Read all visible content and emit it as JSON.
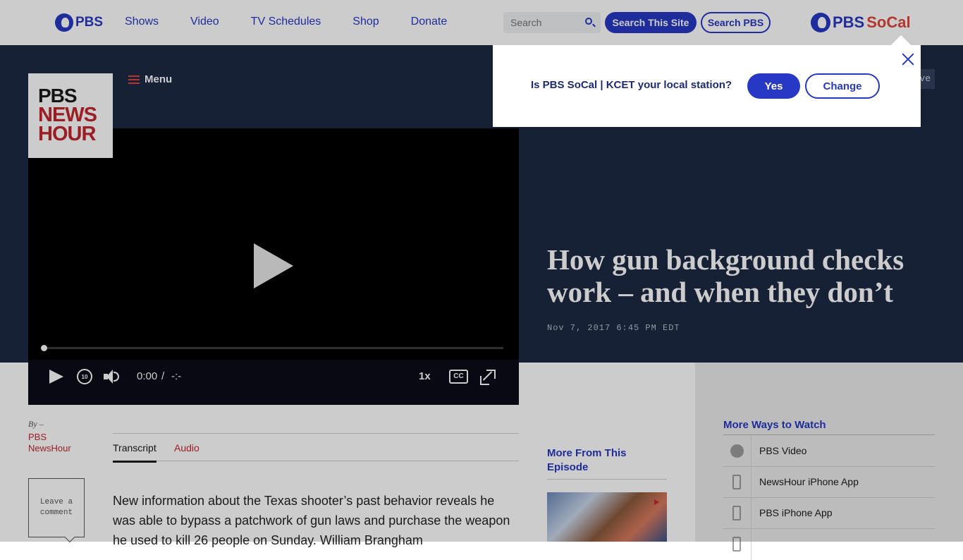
{
  "topbar": {
    "logo_text": "PBS",
    "nav": [
      "Shows",
      "Video",
      "TV Schedules",
      "Shop",
      "Donate"
    ],
    "search_placeholder": "Search",
    "search_site_label": "Search This Site",
    "search_pbs_label": "Search PBS",
    "station_logo_pbs": "PBS",
    "station_logo_name": "SoCal"
  },
  "newshour": {
    "logo_line1": "PBS",
    "logo_line2": "NEWS",
    "logo_line3": "HOUR",
    "menu_label": "Menu"
  },
  "player": {
    "time_current": "0:00",
    "time_separator": "/",
    "time_total": "-:-",
    "speed": "1x",
    "cc_label": "CC",
    "rewind_label": "10",
    "progress_fraction": 0
  },
  "article": {
    "headline": "How gun background checks work – and when they don’t",
    "date": "Nov 7, 2017 6:45 PM EDT",
    "save_label": "ve",
    "by_label": "By –",
    "author": "PBS NewsHour",
    "comment_label": "Leave a comment",
    "tabs": [
      "Transcript",
      "Audio"
    ],
    "body": "New information about the Texas shooter’s past behavior reveals he was able to bypass a patchwork of gun laws and purchase the weapon he used to kill 26 people on Sunday. William Brangham"
  },
  "popup": {
    "question": "Is PBS SoCal | KCET your local station?",
    "yes_label": "Yes",
    "change_label": "Change"
  },
  "more_episode": {
    "title": "More From This Episode"
  },
  "more_ways": {
    "title": "More Ways to Watch",
    "items": [
      {
        "label": "PBS Video",
        "icon": "pbs-icon"
      },
      {
        "label": "NewsHour iPhone App",
        "icon": "phone-icon"
      },
      {
        "label": "PBS iPhone App",
        "icon": "phone-icon"
      }
    ]
  },
  "colors": {
    "pbs_blue": "#2638c4",
    "newshour_red": "#c1272d",
    "hero_navy": "#1c2a44"
  }
}
